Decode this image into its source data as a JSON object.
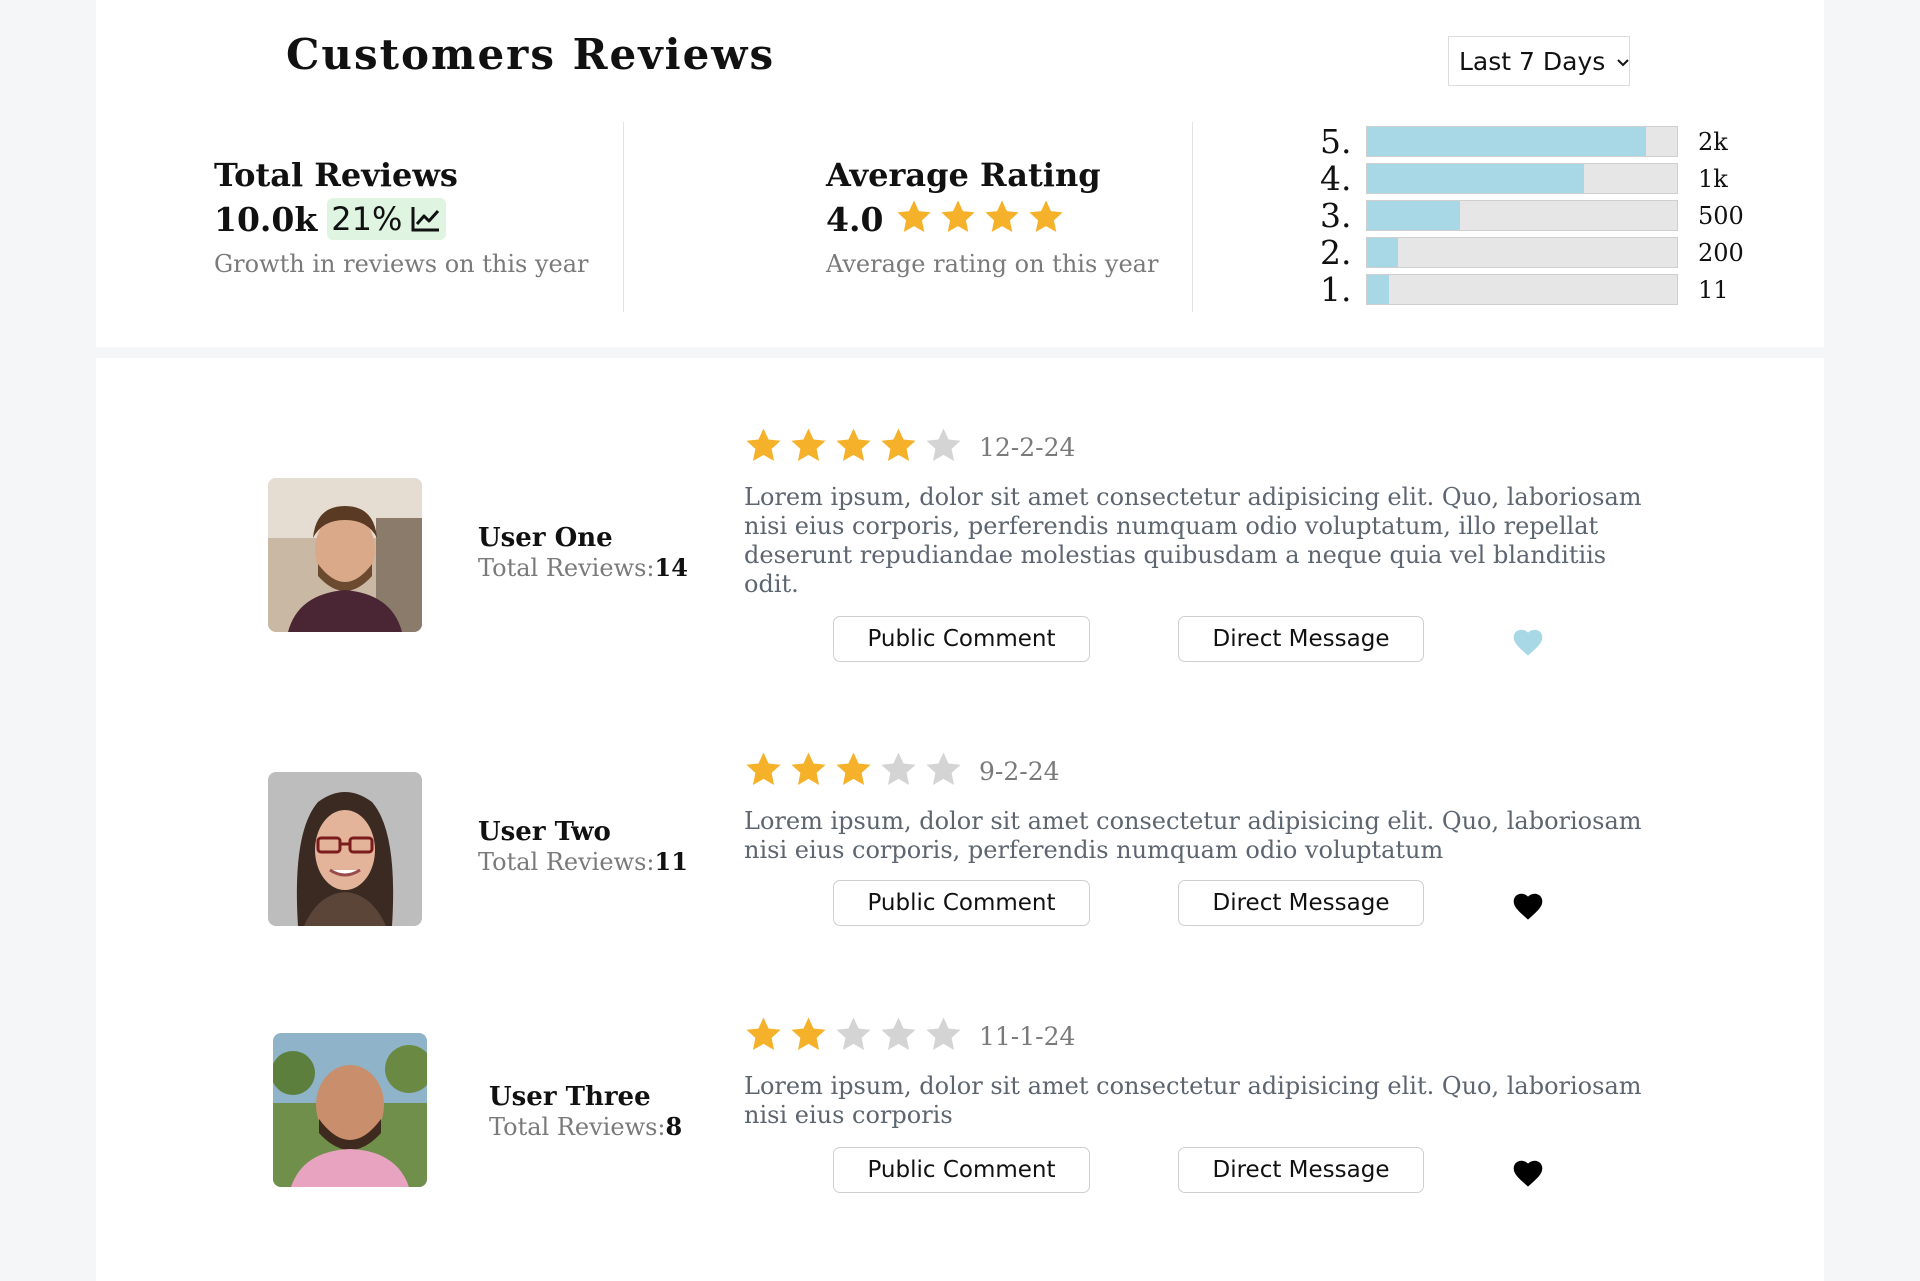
{
  "header": {
    "title": "Customers Reviews",
    "period_select": "Last 7 Days"
  },
  "total_reviews": {
    "title": "Total Reviews",
    "value": "10.0k",
    "growth": "21%",
    "subtitle": "Growth in reviews on this year"
  },
  "average_rating": {
    "title": "Average Rating",
    "value": "4.0",
    "stars": 4,
    "subtitle": "Average rating on this year"
  },
  "rating_distribution": [
    {
      "label": "5.",
      "count": "2k",
      "fraction": 0.9
    },
    {
      "label": "4.",
      "count": "1k",
      "fraction": 0.7
    },
    {
      "label": "3.",
      "count": "500",
      "fraction": 0.3
    },
    {
      "label": "2.",
      "count": "200",
      "fraction": 0.1
    },
    {
      "label": "1.",
      "count": "11",
      "fraction": 0.07
    }
  ],
  "colors": {
    "star_filled": "#f6b12b",
    "star_empty": "#d4d4d4",
    "bar_fill": "#a8d8e6",
    "heart_liked": "#a8d8e6",
    "heart_default": "#000000",
    "growth_badge": "#dff5e1"
  },
  "reviews": [
    {
      "user_name": "User One",
      "total_reviews_label": "Total Reviews:",
      "total_reviews": "14",
      "rating": 4,
      "date": "12-2-24",
      "text": "Lorem ipsum, dolor sit amet consectetur adipisicing elit. Quo, laboriosam nisi eius corporis, perferendis numquam odio voluptatum, illo repellat deserunt repudiandae molestias quibusdam a neque quia vel blanditiis odit.",
      "public_comment": "Public Comment",
      "direct_message": "Direct Message",
      "liked": true
    },
    {
      "user_name": "User Two",
      "total_reviews_label": "Total Reviews:",
      "total_reviews": "11",
      "rating": 3,
      "date": "9-2-24",
      "text": "Lorem ipsum, dolor sit amet consectetur adipisicing elit. Quo, laboriosam nisi eius corporis, perferendis numquam odio voluptatum",
      "public_comment": "Public Comment",
      "direct_message": "Direct Message",
      "liked": false
    },
    {
      "user_name": "User Three",
      "total_reviews_label": "Total Reviews:",
      "total_reviews": "8",
      "rating": 2,
      "date": "11-1-24",
      "text": "Lorem ipsum, dolor sit amet consectetur adipisicing elit. Quo, laboriosam nisi eius corporis",
      "public_comment": "Public Comment",
      "direct_message": "Direct Message",
      "liked": false
    }
  ]
}
